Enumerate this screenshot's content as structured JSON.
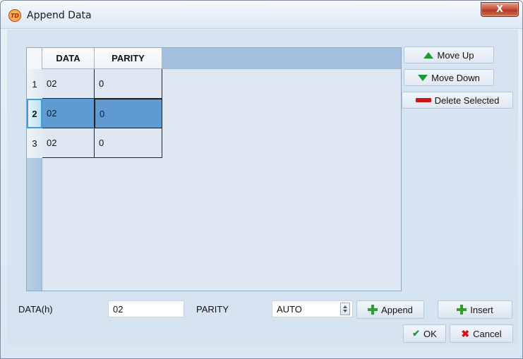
{
  "window": {
    "title": "Append Data",
    "app_icon_text": "TD",
    "close_label": "X"
  },
  "grid": {
    "columns": [
      "DATA",
      "PARITY"
    ],
    "rows": [
      {
        "num": "1",
        "data": "02",
        "parity": "0",
        "selected": false
      },
      {
        "num": "2",
        "data": "02",
        "parity": "0",
        "selected": true
      },
      {
        "num": "3",
        "data": "02",
        "parity": "0",
        "selected": false
      }
    ]
  },
  "side_buttons": {
    "move_up": {
      "label": "Move Up",
      "icon": "arrow-up-icon"
    },
    "move_down": {
      "label": "Move Down",
      "icon": "arrow-down-icon"
    },
    "delete_selected": {
      "label": "Delete Selected",
      "icon": "minus-icon"
    }
  },
  "form": {
    "data_label": "DATA(h)",
    "data_value": "02",
    "parity_label": "PARITY",
    "parity_value": "AUTO"
  },
  "buttons": {
    "append": {
      "label": "Append",
      "icon": "plus-icon"
    },
    "insert": {
      "label": "Insert",
      "icon": "plus-icon"
    },
    "ok": {
      "label": "OK",
      "icon": "check-icon"
    },
    "cancel": {
      "label": "Cancel",
      "icon": "x-icon"
    }
  },
  "colors": {
    "selection": "#5f9bd1",
    "accent_green": "#1b9a2e",
    "accent_red": "#d0141c"
  }
}
